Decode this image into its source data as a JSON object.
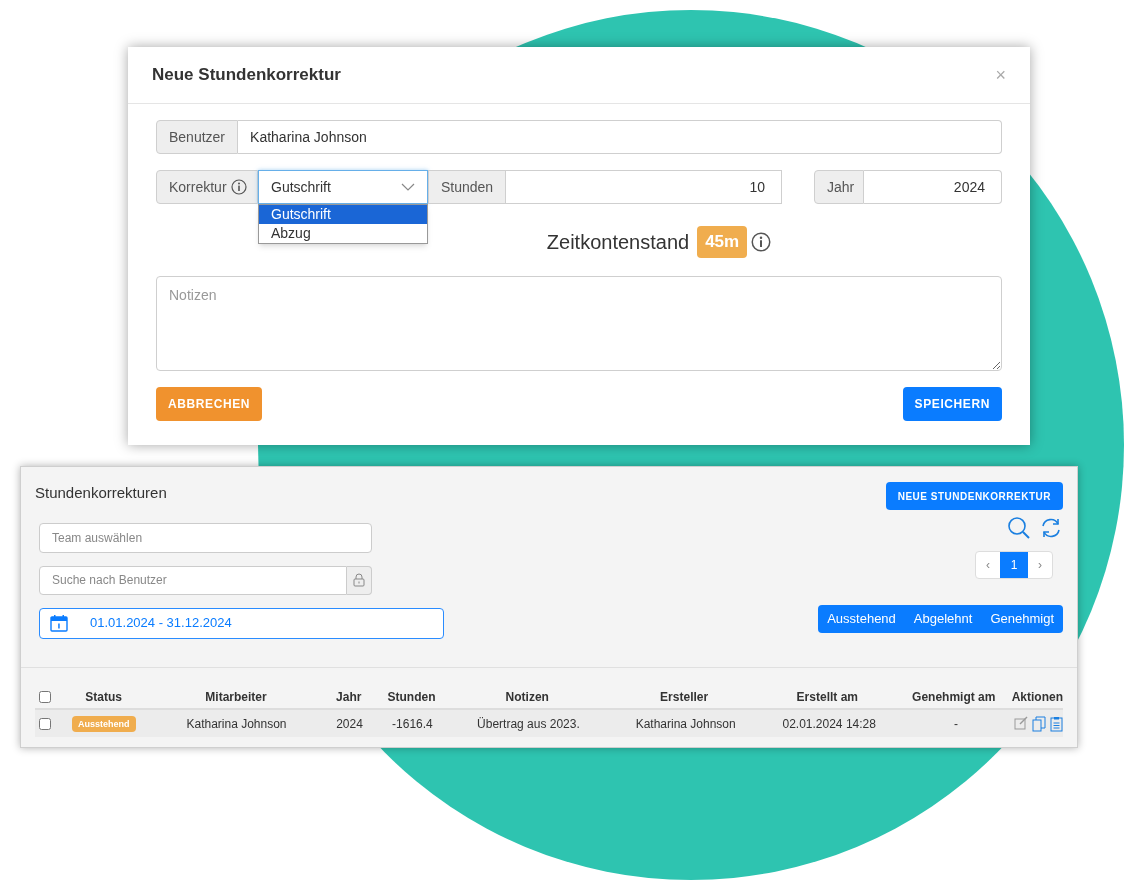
{
  "modal": {
    "title": "Neue Stundenkorrektur",
    "close": "×",
    "user": {
      "label": "Benutzer",
      "value": "Katharina Johnson"
    },
    "correction": {
      "label": "Korrektur",
      "value": "Gutschrift",
      "expanded": true,
      "options": [
        {
          "label": "Gutschrift",
          "selected": true
        },
        {
          "label": "Abzug",
          "selected": false
        }
      ]
    },
    "hours": {
      "label": "Stunden",
      "value": "10"
    },
    "year": {
      "label": "Jahr",
      "value": "2024"
    },
    "balance": {
      "label": "Zeitkontenstand",
      "badge": "45m"
    },
    "notes": {
      "placeholder": "Notizen"
    },
    "cancel": "ABBRECHEN",
    "save": "SPEICHERN"
  },
  "panel": {
    "title": "Stundenkorrekturen",
    "new_button": "NEUE STUNDENKORREKTUR",
    "team": {
      "placeholder": "Team auswählen"
    },
    "user_search": {
      "placeholder": "Suche nach Benutzer"
    },
    "date_range": "01.01.2024 - 31.12.2024",
    "pagination": {
      "prev": "‹",
      "pages": [
        {
          "label": "1",
          "selected": true
        }
      ],
      "next": "›"
    },
    "filters": [
      "Ausstehend",
      "Abgelehnt",
      "Genehmigt"
    ],
    "table": {
      "select_all": {
        "checked": false
      },
      "columns": [
        "Status",
        "Mitarbeiter",
        "Jahr",
        "Stunden",
        "Notizen",
        "Ersteller",
        "Erstellt am",
        "Genehmigt am",
        "Aktionen"
      ],
      "rows": [
        {
          "checked": false,
          "status": "Ausstehend",
          "employee": "Katharina Johnson",
          "year": "2024",
          "hours": "-1616.4",
          "notes": "Übertrag aus 2023.",
          "creator": "Katharina Johnson",
          "created": "02.01.2024 14:28",
          "approved": "-"
        }
      ]
    }
  }
}
